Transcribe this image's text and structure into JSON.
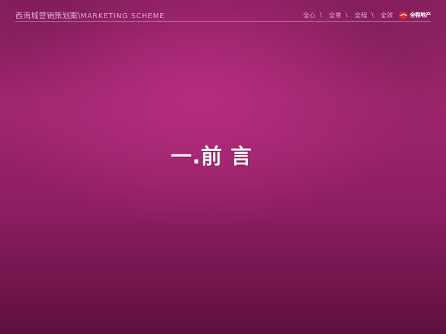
{
  "header": {
    "project_title": "西南城营销策划案",
    "separator": "\\",
    "english_title": "MARKETING SCHEME",
    "tagline": [
      {
        "label": "全心",
        "sep": "\\"
      },
      {
        "label": "全意",
        "sep": "\\"
      },
      {
        "label": "全程",
        "sep": "\\"
      },
      {
        "label": "全效",
        "sep": ""
      }
    ],
    "logo_text": "全程地产",
    "logo_icon": "red-circle-logo-icon",
    "rule_color": "#d98bb9"
  },
  "main": {
    "title": "一.前 言"
  },
  "colors": {
    "background": "#9e2670",
    "header_text": "#e3a8cb",
    "title_text": "#ffffff",
    "logo_accent": "#d8262b"
  }
}
